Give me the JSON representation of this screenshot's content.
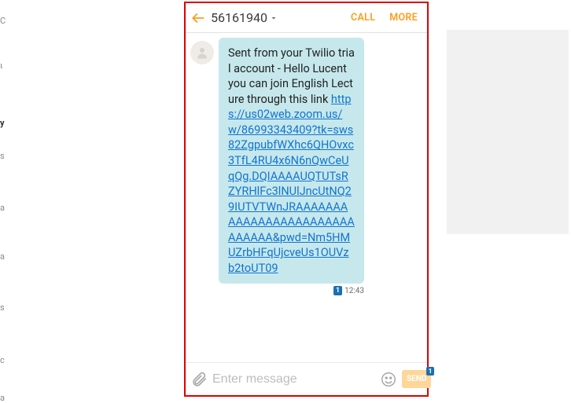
{
  "header": {
    "title": "56161940",
    "call_label": "CALL",
    "more_label": "MORE"
  },
  "message": {
    "sim": "1",
    "time": "12:43",
    "text_prefix": "Sent from your Twilio trial account - Hello Lucent you can join English Lecture through this link ",
    "link": "https://us02web.zoom.us/w/86993343409?tk=sws82ZgpubfWXhc6QHOvxc3TfL4RU4x6N6nQwCeUqQg.DQIAAAAUQTUTsRZYRHlFc3lNUlJncUtNQ29IUTVTWnJRAAAAAAAAAAAAAAAAAAAAAAAAAAAAAA&pwd=Nm5HMUZrbHFqUjcveUs1OUVzb2toUT09"
  },
  "composer": {
    "placeholder": "Enter message",
    "send_label": "SEND",
    "sim_badge": "1"
  },
  "bg_fragments": {
    "f1": "C",
    "f2": "ι",
    "f3": "y",
    "f4": "s",
    "f5": "a",
    "f6": "a",
    "f7": "s",
    "f8": "c",
    "f9": "a"
  }
}
